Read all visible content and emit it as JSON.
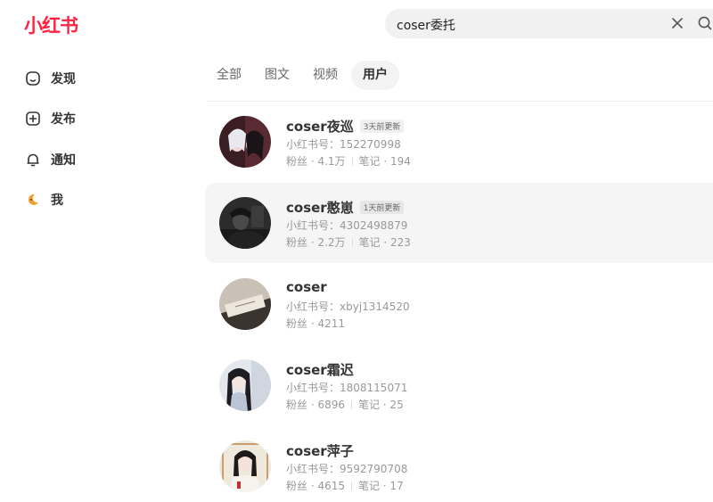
{
  "app": {
    "logo": "小红书"
  },
  "search": {
    "query": "coser委托"
  },
  "sidebar": {
    "items": [
      {
        "label": "发现",
        "icon": "home-icon"
      },
      {
        "label": "发布",
        "icon": "plus-square-icon"
      },
      {
        "label": "通知",
        "icon": "bell-icon"
      },
      {
        "label": "我",
        "icon": "user-avatar-icon"
      }
    ]
  },
  "tabs": [
    "全部",
    "图文",
    "视频",
    "用户"
  ],
  "active_tab": "用户",
  "users": [
    {
      "name": "coser夜巡",
      "badge": "3天前更新",
      "id": "小红书号：152270998",
      "fans": "粉丝 · 4.1万",
      "notes": "笔记 · 194"
    },
    {
      "name": "coser憨崽",
      "badge": "1天前更新",
      "id": "小红书号：4302498879",
      "fans": "粉丝 · 2.2万",
      "notes": "笔记 · 223"
    },
    {
      "name": "coser",
      "badge": "",
      "id": "小红书号：xbyj1314520",
      "fans": "粉丝 · 4211",
      "notes": ""
    },
    {
      "name": "coser霜迟",
      "badge": "",
      "id": "小红书号：1808115071",
      "fans": "粉丝 · 6896",
      "notes": "笔记 · 25"
    },
    {
      "name": "coser萍子",
      "badge": "",
      "id": "小红书号：9592790708",
      "fans": "粉丝 · 4615",
      "notes": "笔记 · 17"
    }
  ],
  "colors": {
    "brand": "#ff2442",
    "hover_bg": "#f5f5f5"
  }
}
